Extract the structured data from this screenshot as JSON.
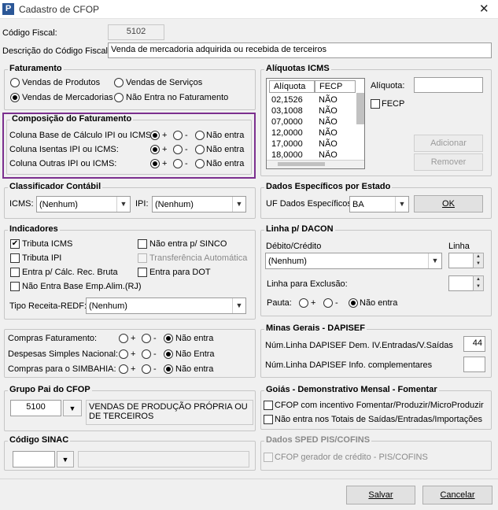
{
  "window": {
    "title": "Cadastro de CFOP",
    "app_icon": "P",
    "close": "✕"
  },
  "codigo_fiscal": {
    "label": "Código Fiscal:",
    "value": "5102"
  },
  "descricao": {
    "label": "Descrição do Código Fiscal:",
    "value": "Venda de mercadoria adquirida ou recebida de terceiros"
  },
  "faturamento": {
    "title": "Faturamento",
    "opt1": "Vendas de Produtos",
    "opt2": "Vendas de Serviços",
    "opt3": "Vendas de Mercadorias",
    "opt4": "Não Entra no Faturamento"
  },
  "composicao": {
    "title": "Composição do Faturamento",
    "row1": "Coluna Base de Cálculo IPI ou ICMS:",
    "row2": "Coluna Isentas IPI ou ICMS:",
    "row3": "Coluna Outras IPI ou ICMS:",
    "plus": "+",
    "minus": "-",
    "nao": "Não entra"
  },
  "aliquotas": {
    "title": "Alíquotas ICMS",
    "col1": "Alíquota",
    "col2": "FECP",
    "rows": [
      [
        "02,1526",
        "NÃO"
      ],
      [
        "03,1008",
        "NÃO"
      ],
      [
        "07,0000",
        "NÃO"
      ],
      [
        "12,0000",
        "NÃO"
      ],
      [
        "17,0000",
        "NÃO"
      ],
      [
        "18,0000",
        "NÃO"
      ]
    ],
    "aliquota_label": "Alíquota:",
    "fecp_label": "FECP",
    "adicionar": "Adicionar",
    "remover": "Remover"
  },
  "classificador": {
    "title": "Classificador Contábil",
    "icms_label": "ICMS:",
    "icms_value": "(Nenhum)",
    "ipi_label": "IPI:",
    "ipi_value": "(Nenhum)"
  },
  "dados_estado": {
    "title": "Dados Específicos por Estado",
    "uf_label": "UF Dados Específicos:",
    "uf_value": "BA",
    "ok": "OK"
  },
  "indicadores": {
    "title": "Indicadores",
    "tributa_icms": "Tributa ICMS",
    "tributa_ipi": "Tributa IPI",
    "entra_calc": "Entra p/ Cálc. Rec. Bruta",
    "nao_base": "Não Entra Base Emp.Alim.(RJ)",
    "nao_sinco": "Não entra p/ SINCO",
    "transferencia": "Transferência Automática",
    "entra_dot": "Entra para DOT",
    "receita_label": "Tipo Receita-REDF:",
    "receita_value": "(Nenhum)"
  },
  "dacon": {
    "title": "Linha p/ DACON",
    "debito_label": "Débito/Crédito",
    "linha_label": "Linha",
    "debito_value": "(Nenhum)",
    "exclusao_label": "Linha para Exclusão:",
    "pauta_label": "Pauta:",
    "plus": "+",
    "minus": "-",
    "nao": "Não entra"
  },
  "compras": {
    "row1": "Compras Faturamento:",
    "row2": "Despesas Simples Nacional:",
    "row3": "Compras para o SIMBAHIA:",
    "plus": "+",
    "minus": "-",
    "nao1": "Não entra",
    "nao2": "Não Entra",
    "nao3": "Não entra"
  },
  "minas": {
    "title": "Minas Gerais - DAPISEF",
    "linha1_label": "Núm.Linha DAPISEF Dem. IV.Entradas/V.Saídas",
    "linha1_value": "44",
    "linha2_label": "Núm.Linha DAPISEF Info. complementares"
  },
  "grupo": {
    "title": "Grupo Pai do CFOP",
    "code": "5100",
    "desc": "VENDAS DE PRODUÇÃO PRÓPRIA OU DE TERCEIROS"
  },
  "goias": {
    "title": "Goiás - Demonstrativo Mensal - Fomentar",
    "chk1": "CFOP com incentivo  Fomentar/Produzir/MicroProduzir",
    "chk2": "Não entra nos Totais de  Saídas/Entradas/Importações"
  },
  "sinac": {
    "title": "Código SINAC"
  },
  "sped": {
    "title": "Dados SPED PIS/COFINS",
    "chk": "CFOP gerador de crédito - PIS/COFINS"
  },
  "footer": {
    "salvar": "Salvar",
    "cancelar": "Cancelar"
  }
}
